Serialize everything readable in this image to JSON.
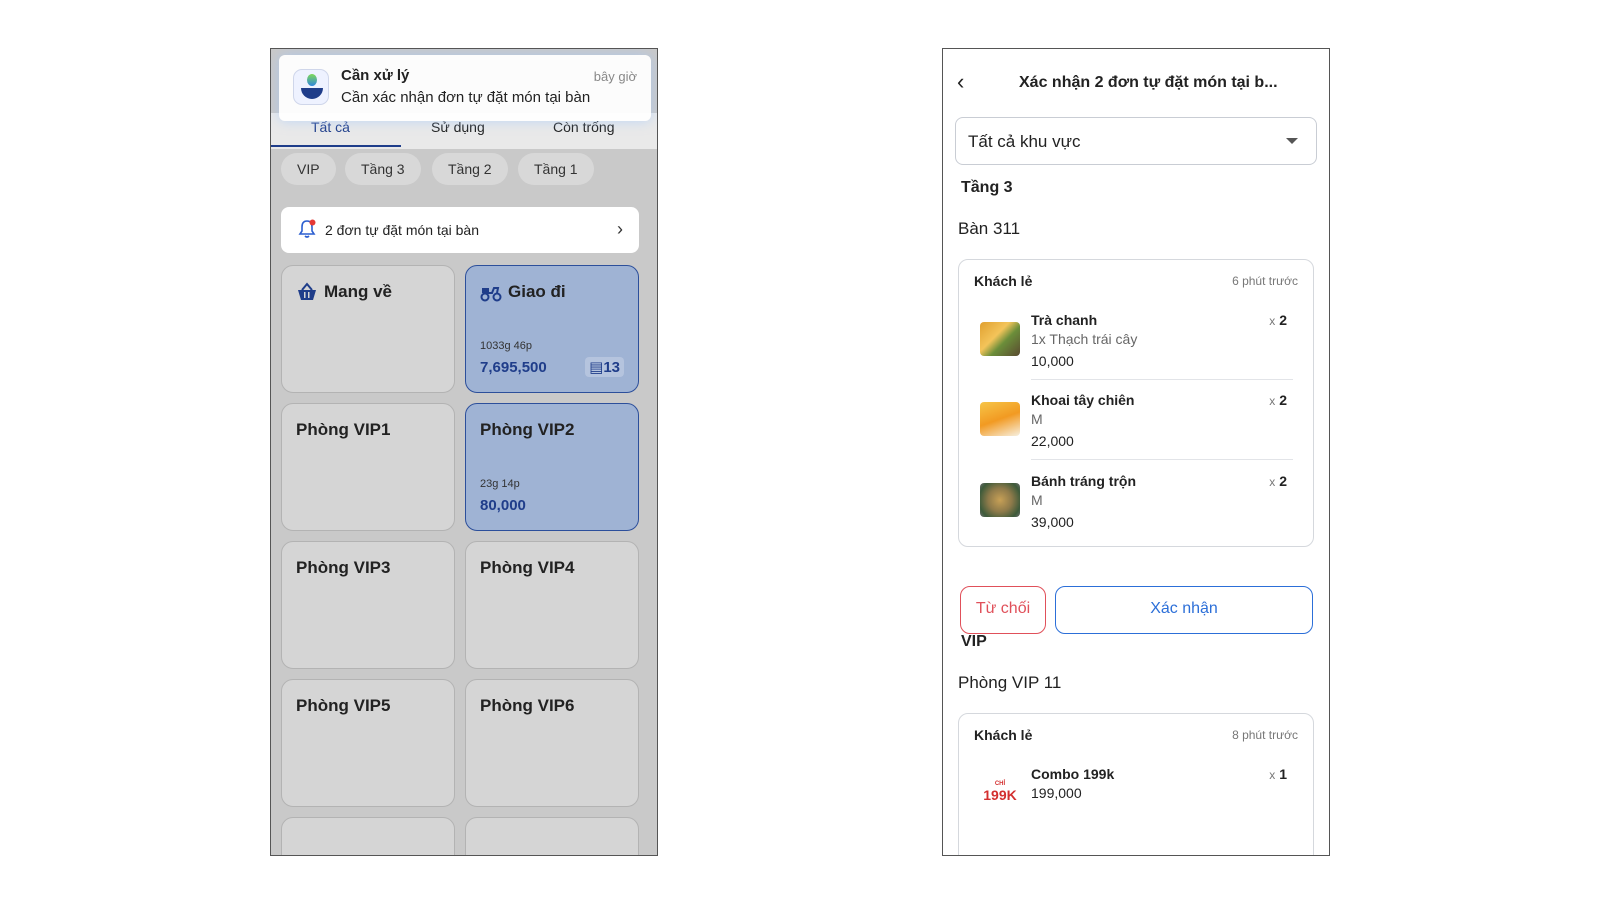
{
  "left_screen": {
    "notification": {
      "title": "Cần xử lý",
      "time": "bây giờ",
      "body": "Cần xác nhận đơn tự đặt món tại bàn"
    },
    "tabs": [
      "Tất cả",
      "Sử dụng",
      "Còn trống"
    ],
    "active_tab": "Tất cả",
    "area_chips": [
      "VIP",
      "Tầng 3",
      "Tầng 2",
      "Tầng 1"
    ],
    "order_banner": {
      "text": "2 đơn tự đặt món tại bàn",
      "icon": "bell-icon"
    },
    "cards": [
      {
        "title": "Mang về",
        "icon": "basket-icon",
        "active": false
      },
      {
        "title": "Giao đi",
        "icon": "scooter-icon",
        "active": true,
        "meta": "1033g 46p",
        "amount": "7,695,500",
        "count": "13"
      },
      {
        "title": "Phòng VIP1",
        "active": false
      },
      {
        "title": "Phòng VIP2",
        "active": true,
        "meta": "23g 14p",
        "amount": "80,000"
      },
      {
        "title": "Phòng VIP3",
        "active": false
      },
      {
        "title": "Phòng VIP4",
        "active": false
      },
      {
        "title": "Phòng VIP5",
        "active": false
      },
      {
        "title": "Phòng VIP6",
        "active": false
      }
    ],
    "colors": {
      "active_card": "#9fb3d4",
      "accent": "#1f3d8a"
    }
  },
  "right_screen": {
    "header_title": "Xác nhận 2 đơn tự đặt món tại b...",
    "area_select": "Tất cả khu vực",
    "groups": [
      {
        "area": "Tầng 3",
        "table": "Bàn 311",
        "customer": "Khách lẻ",
        "ago": "6 phút trước",
        "items": [
          {
            "name": "Trà chanh",
            "option": "1x Thạch trái cây",
            "price": "10,000",
            "qty_prefix": "x",
            "qty": "2"
          },
          {
            "name": "Khoai tây chiên",
            "option": "M",
            "price": "22,000",
            "qty_prefix": "x",
            "qty": "2"
          },
          {
            "name": "Bánh tráng trộn",
            "option": "M",
            "price": "39,000",
            "qty_prefix": "x",
            "qty": "2"
          }
        ]
      },
      {
        "area": "VIP",
        "table": "Phòng VIP 11",
        "customer": "Khách lẻ",
        "ago": "8 phút trước",
        "items": [
          {
            "name": "Combo 199k",
            "price": "199,000",
            "qty_prefix": "x",
            "qty": "1",
            "logo_small": "CHỈ",
            "logo_big": "199K"
          }
        ]
      }
    ],
    "buttons": {
      "reject": "Từ chối",
      "confirm": "Xác nhận"
    },
    "colors": {
      "reject": "#e0505a",
      "confirm": "#2c6fd8"
    }
  }
}
